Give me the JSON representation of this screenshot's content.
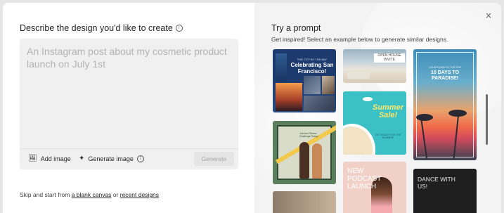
{
  "left": {
    "title": "Describe the design you'd like to create",
    "prompt_placeholder": "An Instagram post about my cosmetic product launch on July 1st",
    "add_image_label": "Add image",
    "generate_image_label": "Generate image",
    "generate_button_label": "Generate",
    "skip_prefix": "Skip and start from",
    "blank_canvas_link": "a blank canvas",
    "or_text": "or",
    "recent_designs_link": "recent designs"
  },
  "right": {
    "title": "Try a prompt",
    "subtitle": "Get inspired! Select an example below to generate similar designs.",
    "close_glyph": "×",
    "cards": {
      "sf": {
        "kicker": "THE CITY BY THE BAY",
        "title": "Celebrating San Francisco!"
      },
      "open_house": {
        "title": "OPEN HOUSE INVITE"
      },
      "paradise": {
        "kicker": "COUNTDOWN TO THE TRIP",
        "title": "10 DAYS TO PARADISE!"
      },
      "summer": {
        "title": "Summer Sale!",
        "subtitle": "GET READY FOR THE SUMMER!"
      },
      "fitness": {
        "title": "Join the Fitness Challenge Today!"
      },
      "podcast": {
        "title": "NEW PODCAST LAUNCH"
      },
      "dance": {
        "title": "DANCE WITH US!"
      }
    }
  },
  "icons": {
    "info": "info-icon",
    "add_image": "image-add-icon",
    "generate_image": "sparkle-icon",
    "close": "close-icon"
  }
}
